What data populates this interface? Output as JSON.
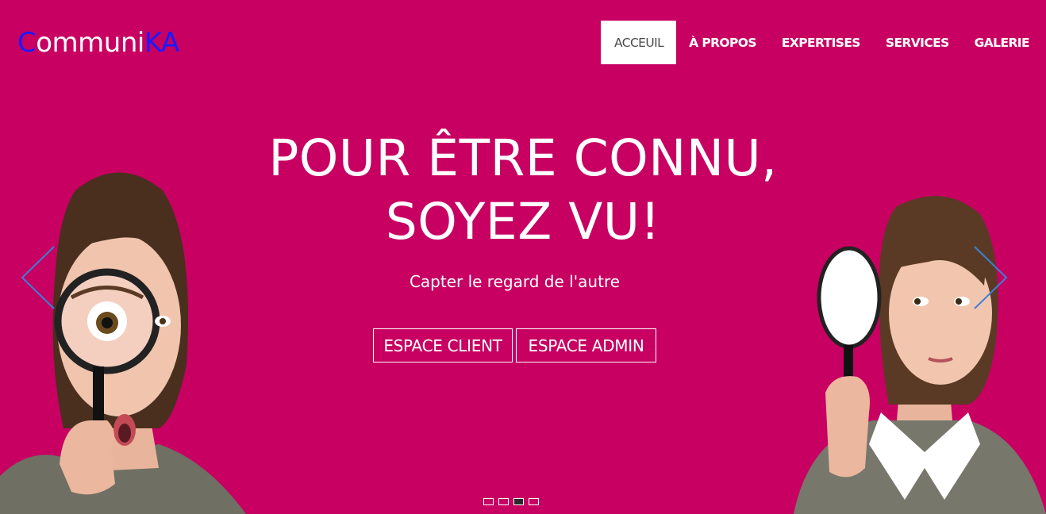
{
  "logo": {
    "part1": "C",
    "part2": "ommuni",
    "part3": "KA"
  },
  "nav": {
    "items": [
      {
        "label": "ACCEUIL"
      },
      {
        "label": "À PROPOS"
      },
      {
        "label": "EXPERTISES"
      },
      {
        "label": "SERVICES"
      },
      {
        "label": "GALERIE"
      }
    ]
  },
  "hero": {
    "title_line1": "POUR ÊTRE CONNU,",
    "title_line2": "SOYEZ VU!",
    "subtitle": "Capter le regard de l'autre",
    "btn_client": "ESPACE CLIENT",
    "btn_admin": "ESPACE ADMIN"
  },
  "carousel": {
    "slide_count": 4,
    "active_slide": 3
  },
  "colors": {
    "background": "#c70062",
    "logo_accent": "#1a1aff",
    "arrow": "#3d7fd6"
  },
  "icons": {
    "prev": "chevron-left-icon",
    "next": "chevron-right-icon"
  }
}
